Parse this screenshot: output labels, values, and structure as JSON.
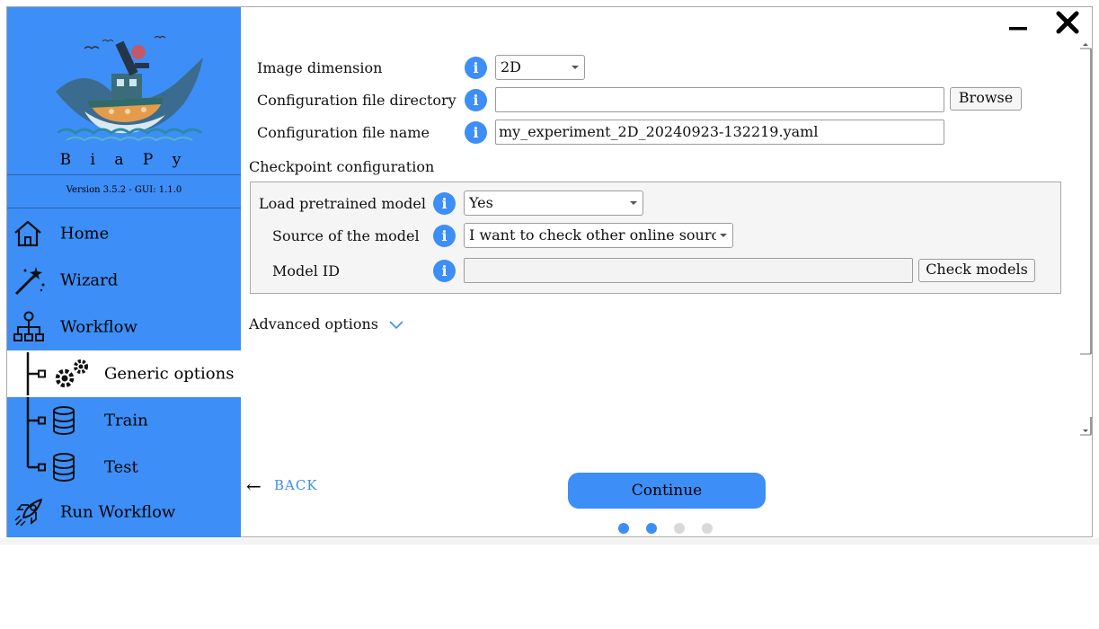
{
  "app": {
    "brand": "B i a P y",
    "version": "Version 3.5.2 - GUI: 1.1.0"
  },
  "window_controls": {
    "minimize_icon": "minimize-icon",
    "close_icon": "close-icon"
  },
  "sidebar": {
    "items": [
      {
        "label": "Home",
        "icon": "home-icon"
      },
      {
        "label": "Wizard",
        "icon": "magic-wand-icon"
      },
      {
        "label": "Workflow",
        "icon": "workflow-icon"
      },
      {
        "label": "Generic options",
        "icon": "gears-icon",
        "active": true
      },
      {
        "label": "Train",
        "icon": "database-icon"
      },
      {
        "label": "Test",
        "icon": "database-icon"
      },
      {
        "label": "Run Workflow",
        "icon": "rocket-icon"
      }
    ]
  },
  "form": {
    "image_dimension": {
      "label": "Image dimension",
      "value": "2D"
    },
    "config_dir": {
      "label": "Configuration file directory",
      "value": "",
      "button": "Browse"
    },
    "config_name": {
      "label": "Configuration file name",
      "value": "my_experiment_2D_20240923-132219.yaml"
    },
    "checkpoint_title": "Checkpoint configuration",
    "load_pretrained": {
      "label": "Load pretrained model",
      "value": "Yes"
    },
    "model_source": {
      "label": "Source of the model",
      "value": "I want to check other online sources"
    },
    "model_id": {
      "label": "Model ID",
      "value": "",
      "button": "Check models"
    },
    "advanced": "Advanced options"
  },
  "nav_bottom": {
    "back": "BACK",
    "continue": "Continue",
    "steps_total": 4,
    "steps_done": 2
  },
  "colors": {
    "accent": "#3d8ef6",
    "inactive_dot": "#d9d9d9",
    "panel_bg": "#f5f5f5"
  }
}
